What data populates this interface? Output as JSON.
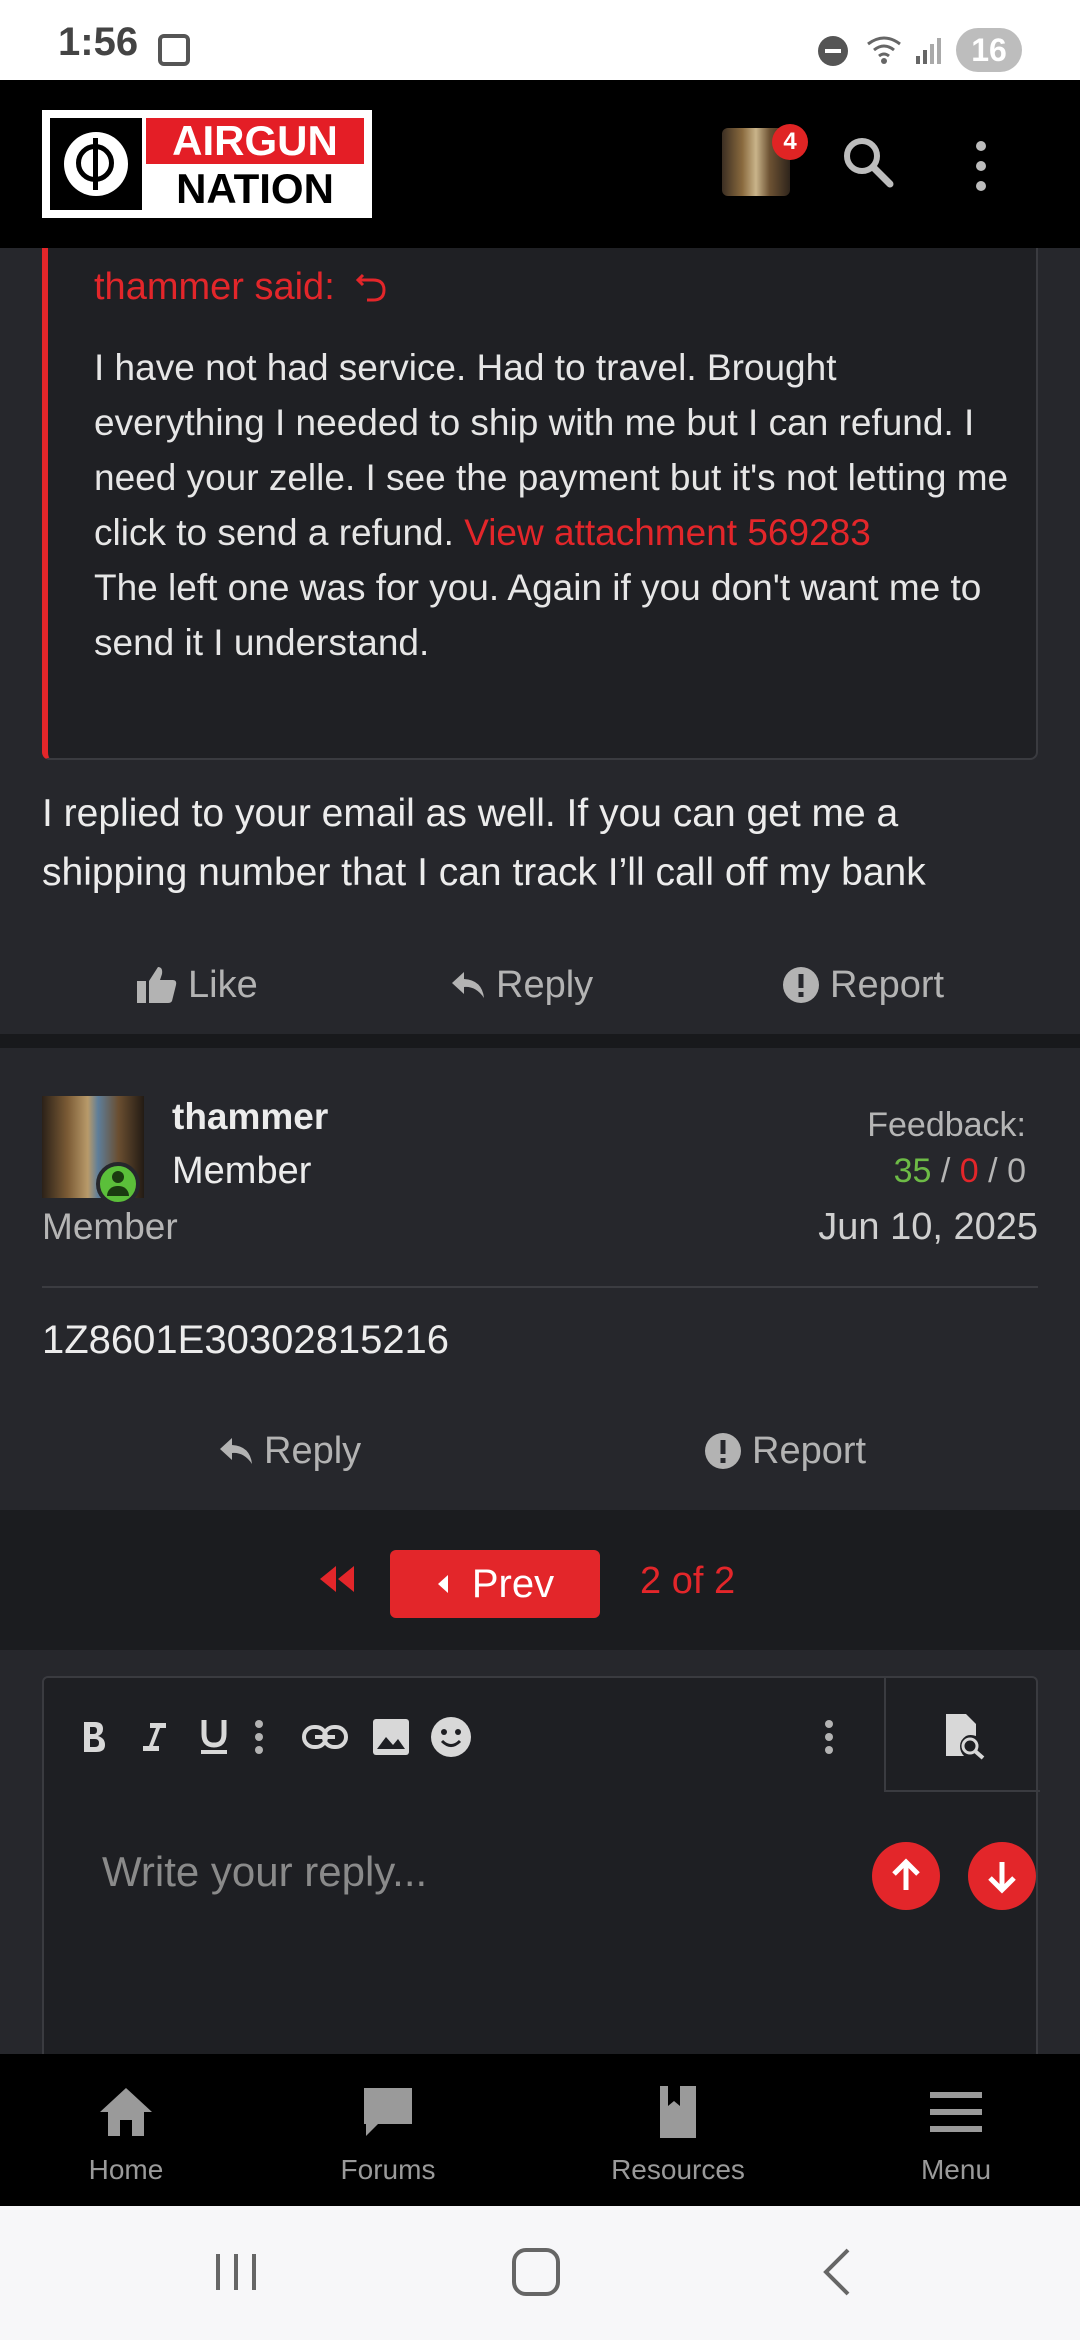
{
  "status_bar": {
    "time": "1:56",
    "battery": "16"
  },
  "header": {
    "brand_line1": "AIRGUN",
    "brand_line2": "NATION",
    "notification_count": "4"
  },
  "quote": {
    "author": "thammer said:",
    "text": "I have not had service. Had to travel. Brought everything I needed to ship with me but I can refund. I need your zelle. I see the payment but it's not letting me click to send a refund.",
    "link": "View attachment 569283",
    "text2": "The left one was for you. Again if you don't want me to send it I understand."
  },
  "post1": {
    "body": "I replied to your email as well. If you can get me a shipping number that I can track I’ll call off my bank",
    "like_label": "Like",
    "reply_label": "Reply",
    "report_label": "Report"
  },
  "post2": {
    "username": "thammer",
    "role": "Member",
    "role_secondary": "Member",
    "feedback_label": "Feedback:",
    "feedback_positive": "35",
    "feedback_neutral": "0",
    "feedback_negative": "0",
    "date": "Jun 10, 2025",
    "body": "1Z8601E30302815216",
    "reply_label": "Reply",
    "report_label": "Report"
  },
  "pager": {
    "prev_label": "Prev",
    "info": "2 of 2"
  },
  "editor": {
    "placeholder": "Write your reply..."
  },
  "bottom_nav": [
    {
      "label": "Home",
      "icon": "home-icon"
    },
    {
      "label": "Forums",
      "icon": "chat-icon"
    },
    {
      "label": "Resources",
      "icon": "book-icon"
    },
    {
      "label": "Menu",
      "icon": "menu-icon"
    }
  ],
  "colors": {
    "accent": "#e3262a",
    "positive": "#6dbb46",
    "background": "#26272c"
  }
}
